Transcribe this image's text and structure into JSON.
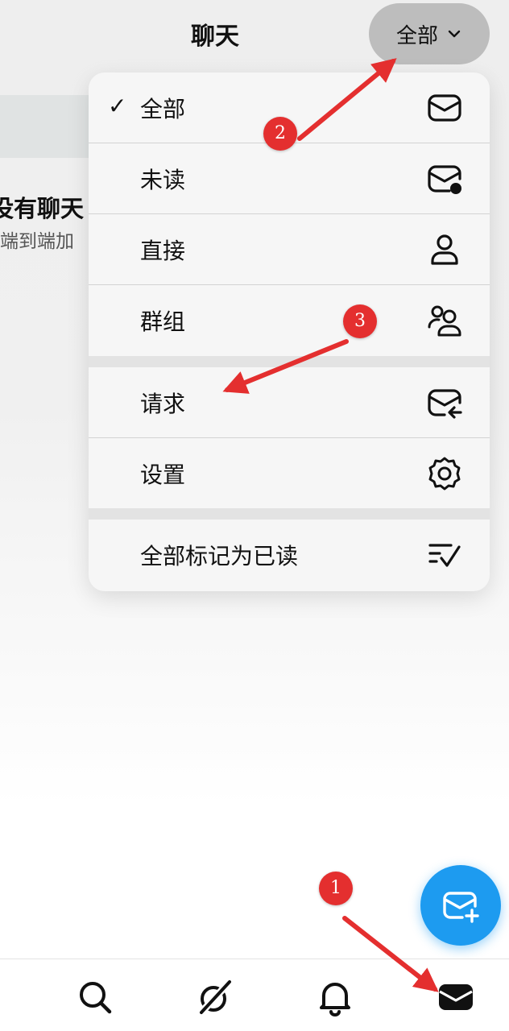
{
  "header": {
    "title": "聊天",
    "filter_label": "全部"
  },
  "background": {
    "empty_title": "没有聊天",
    "empty_subtitle": "端到端加"
  },
  "menu": {
    "items": [
      {
        "label": "全部",
        "icon": "mail-icon",
        "checked": true
      },
      {
        "label": "未读",
        "icon": "mail-unread-icon",
        "checked": false
      },
      {
        "label": "直接",
        "icon": "person-icon",
        "checked": false
      },
      {
        "label": "群组",
        "icon": "group-icon",
        "checked": false
      },
      {
        "label": "请求",
        "icon": "mail-request-icon",
        "checked": false
      },
      {
        "label": "设置",
        "icon": "gear-icon",
        "checked": false
      },
      {
        "label": "全部标记为已读",
        "icon": "mark-read-icon",
        "checked": false
      }
    ],
    "check_glyph": "✓"
  },
  "fab": {
    "icon": "compose-message-icon"
  },
  "tabbar": {
    "tabs": [
      {
        "icon": "search-icon"
      },
      {
        "icon": "grok-icon"
      },
      {
        "icon": "bell-icon"
      },
      {
        "icon": "mail-filled-icon",
        "active": true
      }
    ]
  },
  "annotations": {
    "badges": [
      "1",
      "2",
      "3"
    ],
    "color": "#e42f2f"
  },
  "colors": {
    "accent": "#1d9bf0",
    "annotation": "#e42f2f"
  }
}
